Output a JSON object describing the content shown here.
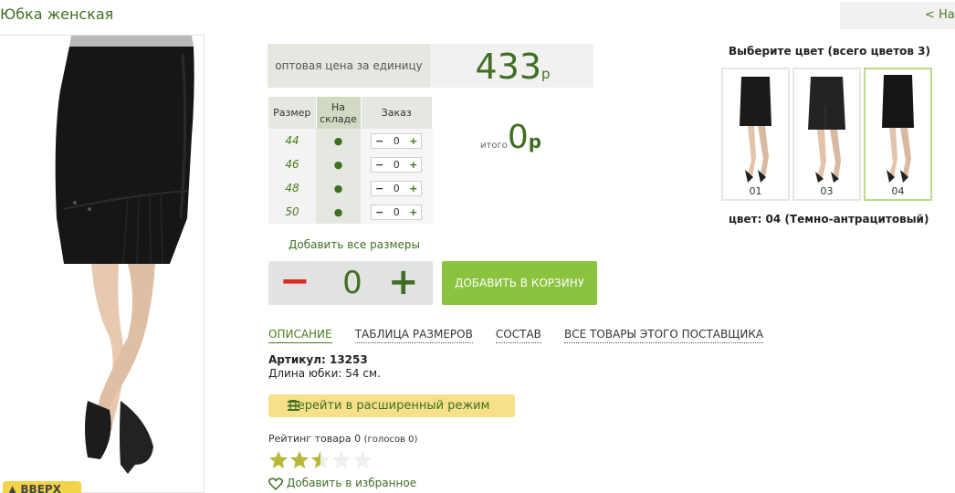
{
  "product": {
    "title": "Юбка женская",
    "back_link": "< На"
  },
  "price": {
    "label": "оптовая цена за единицу",
    "value": "433",
    "currency": "р"
  },
  "size_table": {
    "headers": {
      "size": "Размер",
      "stock_line1": "На",
      "stock_line2": "складе",
      "order": "Заказ"
    },
    "rows": [
      {
        "size": "44",
        "stock": "●",
        "qty": "0",
        "minus": "−",
        "plus": "+"
      },
      {
        "size": "46",
        "stock": "●",
        "qty": "0",
        "minus": "−",
        "plus": "+"
      },
      {
        "size": "48",
        "stock": "●",
        "qty": "0",
        "minus": "−",
        "plus": "+"
      },
      {
        "size": "50",
        "stock": "●",
        "qty": "0",
        "minus": "−",
        "plus": "+"
      }
    ]
  },
  "total": {
    "label": "итого",
    "value": "0",
    "currency": "р"
  },
  "add_all_sizes": "Добавить все размеры",
  "quantity": {
    "minus": "−",
    "value": "0",
    "plus": "+"
  },
  "cart_button": "ДОБАВИТЬ В КОРЗИНУ",
  "tabs": [
    "ОПИСАНИЕ",
    "ТАБЛИЦА РАЗМЕРОВ",
    "СОСТАВ",
    "ВСЕ ТОВАРЫ ЭТОГО ПОСТАВЩИКА"
  ],
  "description": {
    "article_label": "Артикул: 13253",
    "length": "Длина юбки: 54 см."
  },
  "advanced_mode": "Перейти в расширенный режим",
  "rating": {
    "text": "Рейтинг товара 0",
    "votes": "(голосов 0)",
    "stars_filled": 2.5,
    "stars_total": 5
  },
  "favorite": "Добавить в избранное",
  "up_button": "▲ ВВЕРХ",
  "colors": {
    "title": "Выберите цвет (всего цветов 3)",
    "items": [
      {
        "code": "01"
      },
      {
        "code": "03"
      },
      {
        "code": "04"
      }
    ],
    "selected": "цвет: 04 (Темно-антрацитовый)"
  },
  "theme": {
    "accent_green": "#3f6f22",
    "button_green": "#8ac33d",
    "minus_red": "#d82d20",
    "highlight_yellow": "#f7e08a"
  }
}
